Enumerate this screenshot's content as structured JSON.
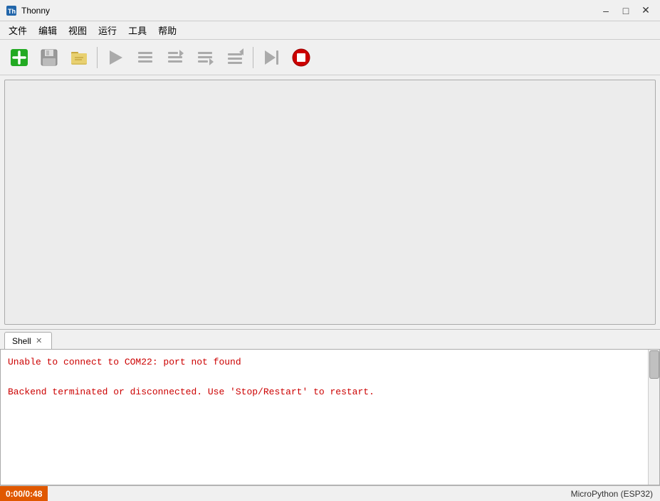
{
  "titlebar": {
    "icon": "Th",
    "title": "Thonny",
    "minimize_label": "–",
    "maximize_label": "□",
    "close_label": "✕"
  },
  "menubar": {
    "items": [
      "文件",
      "编辑",
      "视图",
      "运行",
      "工具",
      "帮助"
    ]
  },
  "toolbar": {
    "buttons": [
      {
        "name": "new-button",
        "label": "+",
        "title": "新建"
      },
      {
        "name": "save-button",
        "label": "💾",
        "title": "保存"
      },
      {
        "name": "open-button",
        "label": "📂",
        "title": "打开"
      },
      {
        "name": "run-button",
        "label": "▶",
        "title": "运行"
      },
      {
        "name": "debug-button",
        "label": "≡",
        "title": "调试"
      },
      {
        "name": "step-over-button",
        "label": "≡→",
        "title": "单步跳过"
      },
      {
        "name": "step-into-button",
        "label": "↓≡",
        "title": "单步进入"
      },
      {
        "name": "step-out-button",
        "label": "↑≡",
        "title": "单步跳出"
      },
      {
        "name": "resume-button",
        "label": "▶|",
        "title": "继续"
      },
      {
        "name": "stop-button",
        "label": "■",
        "title": "停止"
      }
    ]
  },
  "shell": {
    "tab_label": "Shell",
    "tab_close": "✕",
    "line1": "Unable to connect to COM22: port not found",
    "line2": "Backend terminated or disconnected. Use 'Stop/Restart' to restart."
  },
  "statusbar": {
    "time": "0:00/0:48",
    "backend": "MicroPython (ESP32)"
  }
}
